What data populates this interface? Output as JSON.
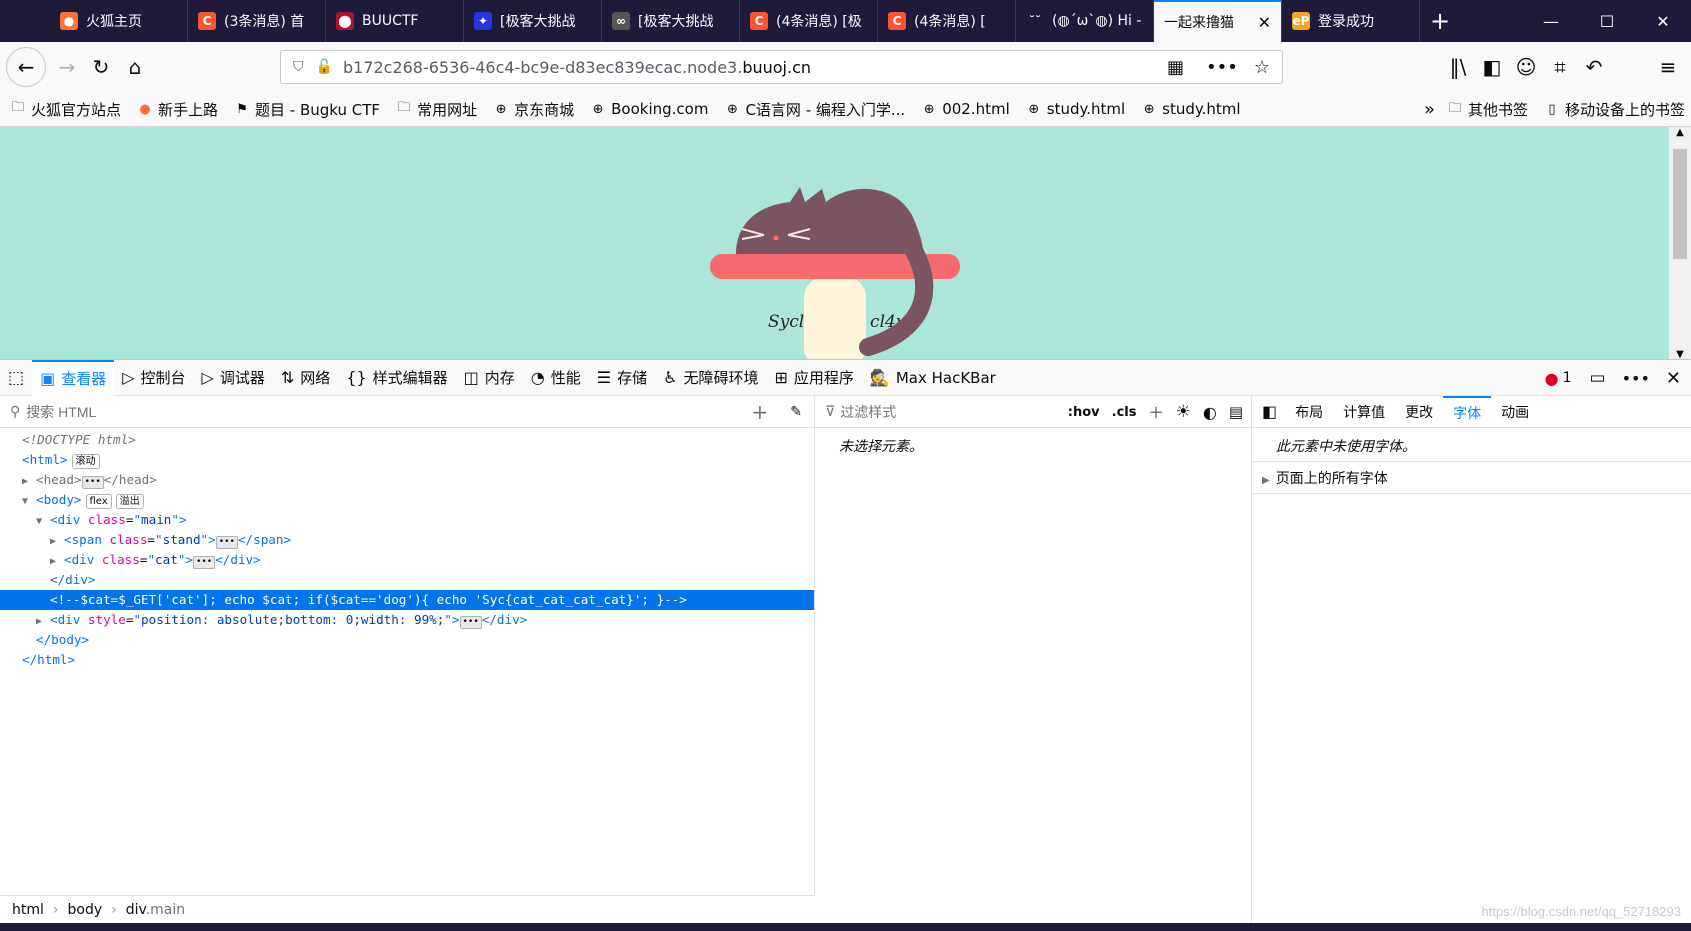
{
  "tabs": [
    {
      "label": "火狐主页",
      "icon": "firefox-icon",
      "color": "#ff7139",
      "glyph": "●"
    },
    {
      "label": "(3条消息) 首",
      "icon": "csdn-icon",
      "color": "#fc5531",
      "glyph": "C"
    },
    {
      "label": "BUUCTF",
      "icon": "buuctf-icon",
      "color": "#b0102b",
      "glyph": "⬤"
    },
    {
      "label": "[极客大挑战",
      "icon": "baidu-icon",
      "color": "#2932e1",
      "glyph": "✦"
    },
    {
      "label": "[极客大挑战",
      "icon": "site-icon",
      "color": "#555555",
      "glyph": "∞"
    },
    {
      "label": "(4条消息) [极",
      "icon": "csdn-icon",
      "color": "#fc5531",
      "glyph": "C"
    },
    {
      "label": "(4条消息) [",
      "icon": "csdn-icon",
      "color": "#fc5531",
      "glyph": "C"
    },
    {
      "label": "(◍´ω`◍) Hi -",
      "icon": "bilibili-icon",
      "color": "#1e1b3a",
      "glyph": "˘˘"
    },
    {
      "label": "一起来撸猫",
      "icon": "",
      "color": "",
      "glyph": ""
    },
    {
      "label": "登录成功",
      "icon": "ep-icon",
      "color": "#f5a623",
      "glyph": "eP"
    }
  ],
  "active_tab_close": "✕",
  "url": {
    "prefix": "b172c268-6536-46c4-bc9e-d83ec839ecac.node3.",
    "domain": "buuoj.cn"
  },
  "bookmarks": [
    {
      "label": "火狐官方站点",
      "icon": "folder-icon",
      "glyph": "🗀"
    },
    {
      "label": "新手上路",
      "icon": "firefox-icon",
      "glyph": "●"
    },
    {
      "label": "题目 - Bugku CTF",
      "icon": "flag-icon",
      "glyph": "⚑"
    },
    {
      "label": "常用网址",
      "icon": "folder-icon",
      "glyph": "🗀"
    },
    {
      "label": "京东商城",
      "icon": "globe-icon",
      "glyph": "⊕"
    },
    {
      "label": "Booking.com",
      "icon": "globe-icon",
      "glyph": "⊕"
    },
    {
      "label": "C语言网 - 编程入门学...",
      "icon": "globe-icon",
      "glyph": "⊕"
    },
    {
      "label": "002.html",
      "icon": "globe-icon",
      "glyph": "⊕"
    },
    {
      "label": "study.html",
      "icon": "globe-icon",
      "glyph": "⊕"
    },
    {
      "label": "study.html",
      "icon": "globe-icon",
      "glyph": "⊕"
    }
  ],
  "bookmarks_right": {
    "other": "其他书签",
    "mobile": "移动设备上的书签"
  },
  "page": {
    "caption": "Syclover @ cl4y"
  },
  "devtools": {
    "tabs": [
      {
        "label": "查看器",
        "icon": "inspector-icon",
        "glyph": "▣"
      },
      {
        "label": "控制台",
        "icon": "console-icon",
        "glyph": "▷"
      },
      {
        "label": "调试器",
        "icon": "debugger-icon",
        "glyph": "▷"
      },
      {
        "label": "网络",
        "icon": "network-icon",
        "glyph": "⇅"
      },
      {
        "label": "样式编辑器",
        "icon": "style-editor-icon",
        "glyph": "{}"
      },
      {
        "label": "内存",
        "icon": "memory-icon",
        "glyph": "◫"
      },
      {
        "label": "性能",
        "icon": "performance-icon",
        "glyph": "◔"
      },
      {
        "label": "存储",
        "icon": "storage-icon",
        "glyph": "☰"
      },
      {
        "label": "无障碍环境",
        "icon": "accessibility-icon",
        "glyph": "♿"
      },
      {
        "label": "应用程序",
        "icon": "application-icon",
        "glyph": "⊞"
      },
      {
        "label": "Max HacKBar",
        "icon": "hackbar-icon",
        "glyph": "🕵"
      }
    ],
    "error_count": "1",
    "search_placeholder": "搜索 HTML",
    "tree": {
      "doctype": "<!DOCTYPE html>",
      "html_badge": "滚动",
      "body_badges": [
        "flex",
        "溢出"
      ],
      "main_div_val": "main",
      "span_val": "stand",
      "cat_val": "cat",
      "comment": "<!--$cat=$_GET['cat']; echo $cat; if($cat=='dog'){ echo 'Syc{cat_cat_cat_cat}'; }-->",
      "style_val": "position: absolute;bottom: 0;width: 99%;"
    },
    "breadcrumbs": [
      "html",
      "body",
      "div",
      ".main"
    ],
    "rules": {
      "filter_placeholder": "过滤样式",
      "hov": ":hov",
      "cls": ".cls",
      "no_element": "未选择元素。"
    },
    "side_tabs": [
      "布局",
      "计算值",
      "更改",
      "字体",
      "动画"
    ],
    "fonts": {
      "message": "此元素中未使用字体。",
      "all_fonts": "页面上的所有字体"
    }
  },
  "watermark": "https://blog.csdn.net/qq_52718293"
}
